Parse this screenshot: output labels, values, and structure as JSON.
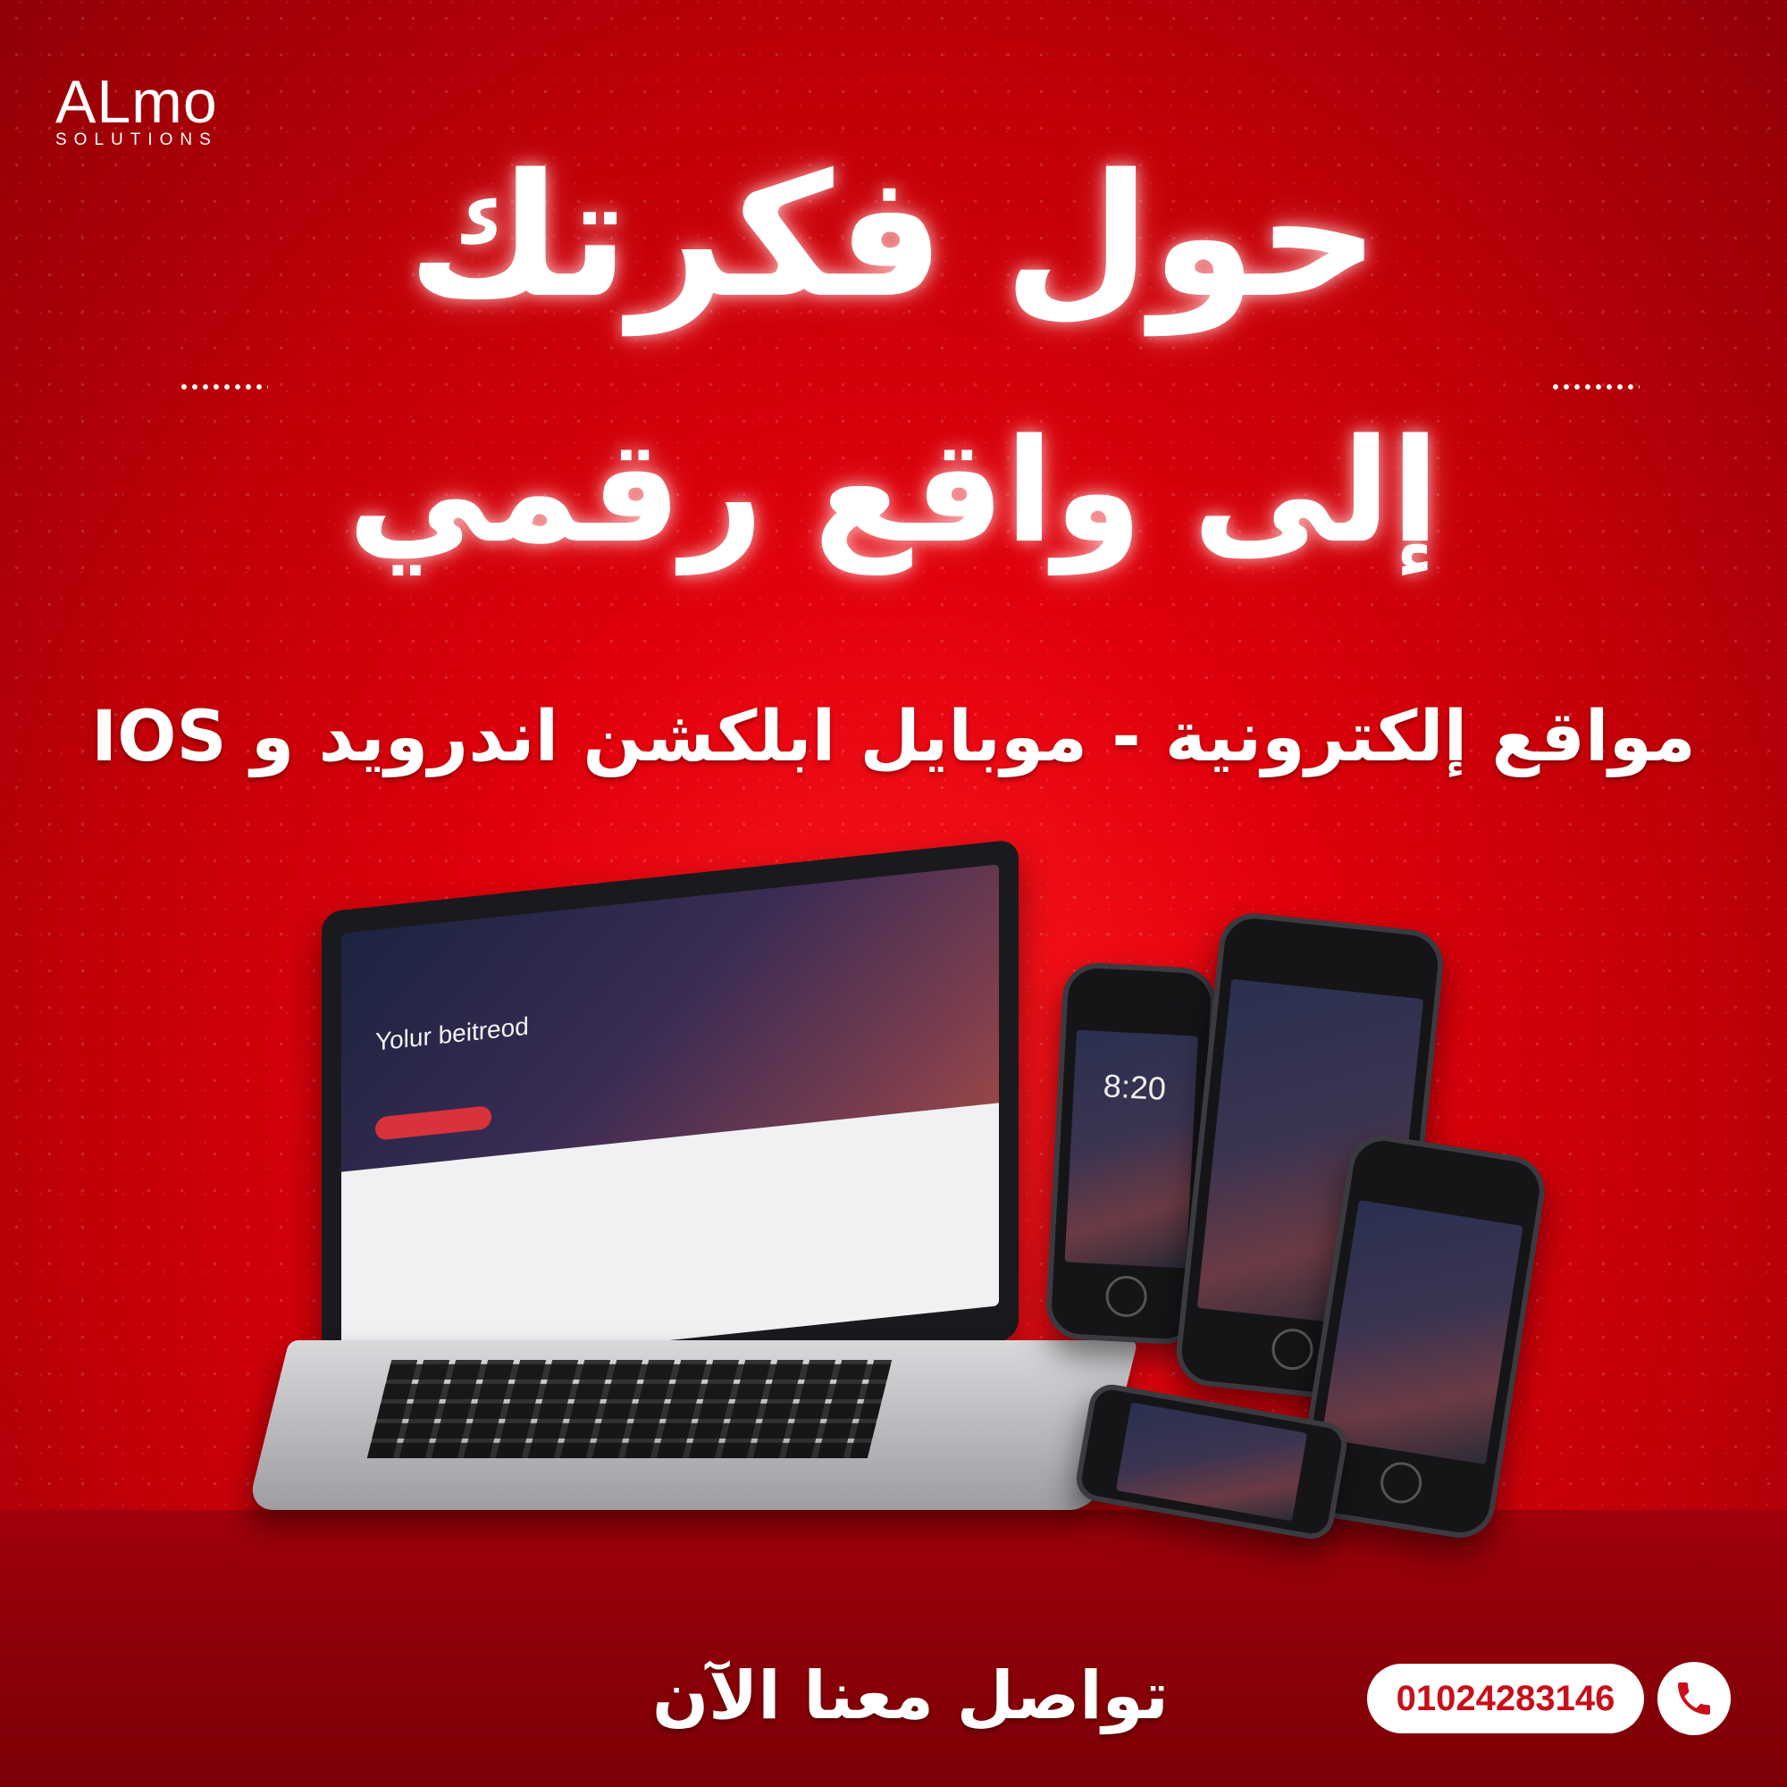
{
  "brand": {
    "logo_word": "ALmo",
    "logo_sub": "SOLUTIONS"
  },
  "headline": {
    "line1": "حول فكرتك",
    "line2": "إلى واقع رقمي"
  },
  "subline": "مواقع إلكترونية - موبايل ابلكشن اندرويد و IOS",
  "devices": {
    "laptop_hero_text": "Yolur beitreod",
    "phone_clock": "8:20"
  },
  "contact": {
    "cta": "تواصل معنا الآن",
    "phone_number": "01024283146",
    "icon": "phone-icon"
  },
  "colors": {
    "primary_red": "#e0000c",
    "accent_white": "#ffffff"
  }
}
